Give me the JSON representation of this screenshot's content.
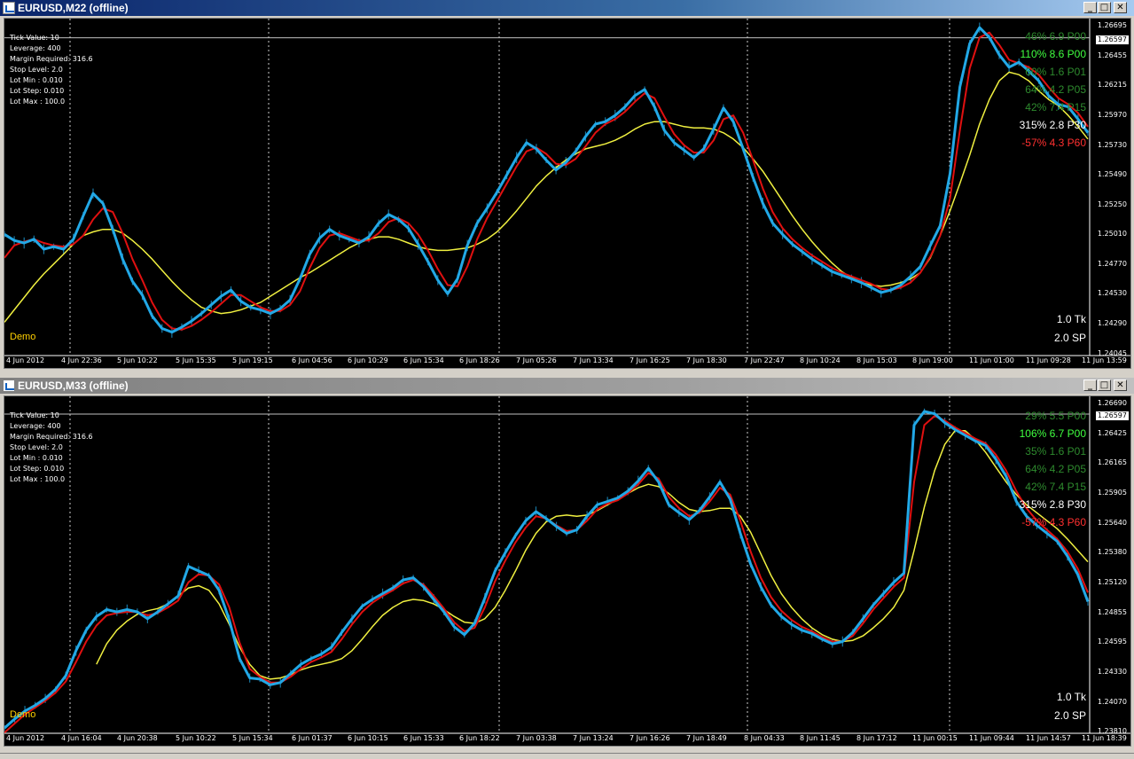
{
  "colors": {
    "price": "#22a8e6",
    "fast_ma": "#e01010",
    "slow_ma": "#f0f040",
    "grid": "#ffffff",
    "bg": "#000000"
  },
  "info_labels": [
    "Tick Value: 10",
    "Leverage: 400",
    "Margin Required: 316.6",
    "Stop Level: 2.0",
    "Lot Min : 0.010",
    "Lot Step: 0.010",
    "Lot Max : 100.0"
  ],
  "windows": [
    {
      "title": "EURUSD,M22 (offline)",
      "current_price": "1.26597",
      "y_ticks": [
        "1.26695",
        "1.26455",
        "1.26215",
        "1.25970",
        "1.25730",
        "1.25490",
        "1.25250",
        "1.25010",
        "1.24770",
        "1.24530",
        "1.24290",
        "1.24045"
      ],
      "x_ticks": [
        "4 Jun 2012",
        "4 Jun 22:36",
        "5 Jun 10:22",
        "5 Jun 15:35",
        "5 Jun 19:15",
        "6 Jun 04:56",
        "6 Jun 10:29",
        "6 Jun 15:34",
        "6 Jun 18:26",
        "7 Jun 05:26",
        "7 Jun 13:34",
        "7 Jun 16:25",
        "7 Jun 18:30",
        "7 Jun 22:47",
        "8 Jun 10:24",
        "8 Jun 15:03",
        "8 Jun 19:00",
        "11 Jun 01:00",
        "11 Jun 09:28",
        "11 Jun 13:59"
      ],
      "overlay": [
        {
          "text": "46% 6.9 P00",
          "color": "#2e8b2e"
        },
        {
          "text": "110% 8.6 P00",
          "color": "#40ff40"
        },
        {
          "text": "60% 1.6 P01",
          "color": "#2e8b2e"
        },
        {
          "text": "64% 4.2 P05",
          "color": "#2e8b2e"
        },
        {
          "text": "42% 7.4 P15",
          "color": "#2e8b2e"
        },
        {
          "text": "315% 2.8 P30",
          "color": "#ffffff"
        },
        {
          "text": "-57% 4.3 P60",
          "color": "#ff3030"
        }
      ],
      "tick_label": "1.0 Tk",
      "spread_label": "2.0 SP",
      "account_label": "Demo",
      "series": {
        "price": [
          1.2501,
          1.2496,
          1.2494,
          1.2497,
          1.2489,
          1.2491,
          1.2489,
          1.2497,
          1.2516,
          1.2534,
          1.2526,
          1.2505,
          1.2481,
          1.2463,
          1.2452,
          1.2435,
          1.2425,
          1.2422,
          1.2426,
          1.2431,
          1.2437,
          1.2444,
          1.2451,
          1.2456,
          1.2447,
          1.2442,
          1.244,
          1.2437,
          1.2441,
          1.2448,
          1.2465,
          1.2485,
          1.2498,
          1.2505,
          1.25,
          1.2497,
          1.2494,
          1.2499,
          1.251,
          1.2517,
          1.2513,
          1.2506,
          1.2493,
          1.2479,
          1.2464,
          1.2453,
          1.2465,
          1.2492,
          1.251,
          1.2522,
          1.2535,
          1.2549,
          1.2563,
          1.2575,
          1.257,
          1.2561,
          1.2553,
          1.2559,
          1.2568,
          1.258,
          1.259,
          1.2592,
          1.2597,
          1.2604,
          1.2613,
          1.2618,
          1.2604,
          1.2585,
          1.2575,
          1.2569,
          1.2563,
          1.257,
          1.2586,
          1.2603,
          1.2592,
          1.257,
          1.2547,
          1.2526,
          1.251,
          1.2501,
          1.2493,
          1.2487,
          1.2481,
          1.2476,
          1.2471,
          1.2468,
          1.2465,
          1.2462,
          1.2458,
          1.2454,
          1.2456,
          1.246,
          1.2467,
          1.2475,
          1.2492,
          1.2508,
          1.255,
          1.262,
          1.2655,
          1.2668,
          1.266,
          1.2646,
          1.2636,
          1.264,
          1.2633,
          1.2625,
          1.2613,
          1.2606,
          1.2604,
          1.2594,
          1.2583
        ],
        "fast_ma": [
          1.2482,
          1.2492,
          1.2495,
          1.2497,
          1.2494,
          1.2492,
          1.2491,
          1.2493,
          1.25,
          1.2513,
          1.2522,
          1.2519,
          1.2502,
          1.2481,
          1.2464,
          1.2446,
          1.2432,
          1.2425,
          1.2424,
          1.2427,
          1.2432,
          1.2438,
          1.2445,
          1.2452,
          1.2452,
          1.2447,
          1.2442,
          1.2439,
          1.2439,
          1.2444,
          1.2455,
          1.2474,
          1.249,
          1.25,
          1.2502,
          1.2499,
          1.2496,
          1.2496,
          1.2502,
          1.2511,
          1.2514,
          1.251,
          1.2501,
          1.2488,
          1.2473,
          1.246,
          1.2459,
          1.2475,
          1.2497,
          1.2514,
          1.2528,
          1.2542,
          1.2556,
          1.2568,
          1.2571,
          1.2566,
          1.2558,
          1.2557,
          1.2562,
          1.2572,
          1.2583,
          1.259,
          1.2594,
          1.26,
          1.2608,
          1.2615,
          1.2611,
          1.2596,
          1.2582,
          1.2573,
          1.2567,
          1.2567,
          1.2577,
          1.2594,
          1.2597,
          1.2583,
          1.2561,
          1.2538,
          1.2519,
          1.2506,
          1.2497,
          1.249,
          1.2484,
          1.2479,
          1.2474,
          1.247,
          1.2467,
          1.2464,
          1.2461,
          1.2457,
          1.2456,
          1.2458,
          1.2462,
          1.247,
          1.2483,
          1.25,
          1.253,
          1.2585,
          1.2635,
          1.266,
          1.2664,
          1.2654,
          1.2642,
          1.2639,
          1.2636,
          1.263,
          1.262,
          1.2611,
          1.2606,
          1.2599,
          1.2588
        ],
        "slow_ma": [
          1.243,
          1.244,
          1.245,
          1.246,
          1.2469,
          1.2477,
          1.2485,
          1.2493,
          1.25,
          1.2503,
          1.2505,
          1.2505,
          1.2502,
          1.2496,
          1.2489,
          1.2481,
          1.2472,
          1.2463,
          1.2455,
          1.2448,
          1.2442,
          1.2439,
          1.2437,
          1.2438,
          1.244,
          1.2443,
          1.2446,
          1.2451,
          1.2456,
          1.2461,
          1.2466,
          1.247,
          1.2475,
          1.248,
          1.2485,
          1.249,
          1.2494,
          1.2497,
          1.2499,
          1.2499,
          1.2497,
          1.2494,
          1.2491,
          1.2489,
          1.2488,
          1.2488,
          1.2489,
          1.249,
          1.2493,
          1.2497,
          1.2503,
          1.2511,
          1.252,
          1.253,
          1.254,
          1.2548,
          1.2555,
          1.2561,
          1.2566,
          1.257,
          1.2572,
          1.2574,
          1.2577,
          1.2581,
          1.2586,
          1.259,
          1.2592,
          1.2592,
          1.259,
          1.2588,
          1.2587,
          1.2587,
          1.2586,
          1.2583,
          1.2578,
          1.2571,
          1.2562,
          1.2552,
          1.254,
          1.2528,
          1.2516,
          1.2505,
          1.2495,
          1.2486,
          1.2478,
          1.2471,
          1.2466,
          1.2462,
          1.246,
          1.2459,
          1.246,
          1.2462,
          1.2465,
          1.247,
          1.2482,
          1.25,
          1.252,
          1.2542,
          1.2565,
          1.259,
          1.261,
          1.2625,
          1.2632,
          1.263,
          1.2625,
          1.2617,
          1.261,
          1.2605,
          1.2597,
          1.2588,
          1.2578
        ]
      }
    },
    {
      "title": "EURUSD,M33 (offline)",
      "current_price": "1.26597",
      "y_ticks": [
        "1.26690",
        "1.26425",
        "1.26165",
        "1.25905",
        "1.25640",
        "1.25380",
        "1.25120",
        "1.24855",
        "1.24595",
        "1.24330",
        "1.24070",
        "1.23810"
      ],
      "x_ticks": [
        "4 Jun 2012",
        "4 Jun 16:04",
        "4 Jun 20:38",
        "5 Jun 10:22",
        "5 Jun 15:34",
        "6 Jun 01:37",
        "6 Jun 10:15",
        "6 Jun 15:33",
        "6 Jun 18:22",
        "7 Jun 03:38",
        "7 Jun 13:24",
        "7 Jun 16:26",
        "7 Jun 18:49",
        "8 Jun 04:33",
        "8 Jun 11:45",
        "8 Jun 17:12",
        "11 Jun 00:15",
        "11 Jun 09:44",
        "11 Jun 14:57",
        "11 Jun 18:39"
      ],
      "overlay": [
        {
          "text": "29% 5.5 P00",
          "color": "#2e8b2e"
        },
        {
          "text": "106% 6.7 P00",
          "color": "#40ff40"
        },
        {
          "text": "35% 1.6 P01",
          "color": "#2e8b2e"
        },
        {
          "text": "64% 4.2 P05",
          "color": "#2e8b2e"
        },
        {
          "text": "42% 7.4 P15",
          "color": "#2e8b2e"
        },
        {
          "text": "315% 2.8 P30",
          "color": "#ffffff"
        },
        {
          "text": "-57% 4.3 P60",
          "color": "#ff3030"
        }
      ],
      "tick_label": "1.0 Tk",
      "spread_label": "2.0 SP",
      "account_label": "Demo",
      "series": {
        "price": [
          1.2384,
          1.2392,
          1.2399,
          1.2404,
          1.241,
          1.2418,
          1.243,
          1.2452,
          1.247,
          1.2482,
          1.2488,
          1.2486,
          1.2488,
          1.2486,
          1.248,
          1.2486,
          1.2493,
          1.25,
          1.2526,
          1.2522,
          1.2518,
          1.2505,
          1.2479,
          1.2445,
          1.2428,
          1.2427,
          1.2422,
          1.2424,
          1.2432,
          1.244,
          1.2445,
          1.2449,
          1.2455,
          1.2468,
          1.248,
          1.2491,
          1.2497,
          1.2502,
          1.2507,
          1.2514,
          1.2516,
          1.2508,
          1.2497,
          1.2486,
          1.2473,
          1.2466,
          1.2476,
          1.2498,
          1.2522,
          1.2538,
          1.2553,
          1.2566,
          1.2574,
          1.2568,
          1.2561,
          1.2555,
          1.2558,
          1.257,
          1.258,
          1.2583,
          1.2586,
          1.2592,
          1.2601,
          1.2612,
          1.26,
          1.258,
          1.2573,
          1.2567,
          1.2575,
          1.2587,
          1.26,
          1.2585,
          1.2555,
          1.2528,
          1.2508,
          1.2492,
          1.2482,
          1.2475,
          1.247,
          1.2467,
          1.2462,
          1.2458,
          1.246,
          1.2468,
          1.248,
          1.2492,
          1.2502,
          1.2512,
          1.252,
          1.265,
          1.2662,
          1.266,
          1.2652,
          1.2646,
          1.2641,
          1.2636,
          1.2632,
          1.262,
          1.2605,
          1.2583,
          1.257,
          1.2562,
          1.2555,
          1.2548,
          1.2535,
          1.2519,
          1.2495
        ],
        "fast_ma": [
          1.238,
          1.2388,
          1.2396,
          1.2402,
          1.2408,
          1.2415,
          1.2425,
          1.2442,
          1.246,
          1.2474,
          1.2483,
          1.2485,
          1.2486,
          1.2486,
          1.2483,
          1.2485,
          1.249,
          1.2496,
          1.2512,
          1.2519,
          1.2518,
          1.251,
          1.249,
          1.2459,
          1.2436,
          1.2429,
          1.2424,
          1.2424,
          1.2429,
          1.2436,
          1.2442,
          1.2446,
          1.2451,
          1.2462,
          1.2475,
          1.2486,
          1.2494,
          1.25,
          1.2505,
          1.2511,
          1.2514,
          1.251,
          1.25,
          1.2489,
          1.2477,
          1.2469,
          1.2472,
          1.249,
          1.2513,
          1.2531,
          1.2547,
          1.256,
          1.257,
          1.2568,
          1.2562,
          1.2557,
          1.2558,
          1.2566,
          1.2576,
          1.2581,
          1.2584,
          1.259,
          1.2598,
          1.2608,
          1.2603,
          1.2587,
          1.2577,
          1.257,
          1.2573,
          1.2583,
          1.2595,
          1.2589,
          1.2566,
          1.2539,
          1.2516,
          1.2499,
          1.2487,
          1.2479,
          1.2473,
          1.2469,
          1.2464,
          1.246,
          1.246,
          1.2465,
          1.2476,
          1.2488,
          1.2498,
          1.2508,
          1.2516,
          1.26,
          1.265,
          1.2658,
          1.2654,
          1.2648,
          1.2643,
          1.2638,
          1.2634,
          1.2624,
          1.261,
          1.2592,
          1.2577,
          1.2566,
          1.2558,
          1.255,
          1.2539,
          1.2524,
          1.2503
        ],
        "slow_ma": [
          null,
          null,
          null,
          null,
          null,
          null,
          null,
          null,
          null,
          1.244,
          1.2458,
          1.247,
          1.2478,
          1.2484,
          1.2487,
          1.2489,
          1.2493,
          1.25,
          1.2507,
          1.2509,
          1.2505,
          1.2493,
          1.2475,
          1.2455,
          1.244,
          1.243,
          1.2427,
          1.2428,
          1.2431,
          1.2435,
          1.2438,
          1.244,
          1.2442,
          1.2445,
          1.2452,
          1.2462,
          1.2473,
          1.2483,
          1.249,
          1.2495,
          1.2497,
          1.2496,
          1.2493,
          1.2488,
          1.2482,
          1.2477,
          1.2476,
          1.248,
          1.249,
          1.2505,
          1.2522,
          1.254,
          1.2555,
          1.2565,
          1.257,
          1.2571,
          1.257,
          1.2571,
          1.2575,
          1.258,
          1.2585,
          1.259,
          1.2595,
          1.2598,
          1.2596,
          1.259,
          1.2582,
          1.2576,
          1.2574,
          1.2575,
          1.2577,
          1.2577,
          1.257,
          1.2556,
          1.2537,
          1.2518,
          1.2502,
          1.249,
          1.248,
          1.2472,
          1.2466,
          1.2462,
          1.246,
          1.2461,
          1.2465,
          1.2472,
          1.248,
          1.249,
          1.2505,
          1.254,
          1.2578,
          1.261,
          1.2633,
          1.2645,
          1.2645,
          1.2637,
          1.2626,
          1.2613,
          1.26,
          1.2589,
          1.258,
          1.2573,
          1.2566,
          1.2559,
          1.255,
          1.254,
          1.253
        ]
      }
    }
  ]
}
